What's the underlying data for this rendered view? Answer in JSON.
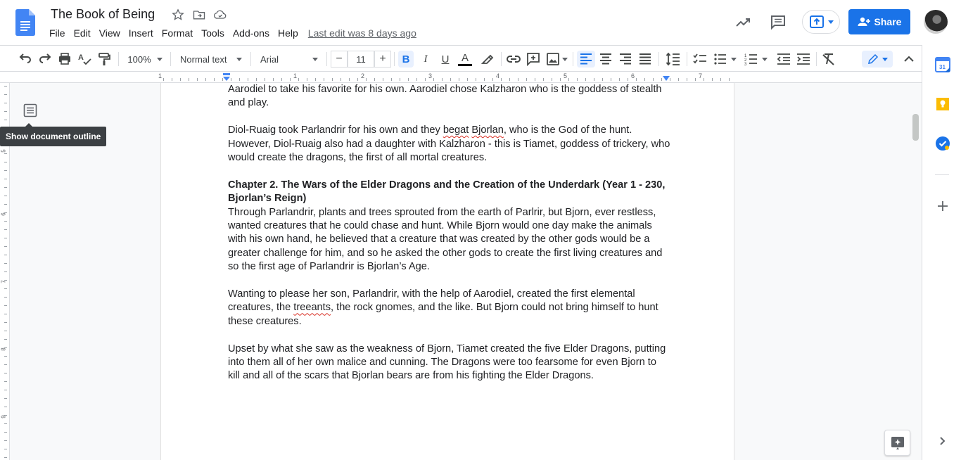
{
  "header": {
    "doc_title": "The Book of Being",
    "menu": [
      "File",
      "Edit",
      "View",
      "Insert",
      "Format",
      "Tools",
      "Add-ons",
      "Help"
    ],
    "last_edit": "Last edit was 8 days ago",
    "share_label": "Share"
  },
  "toolbar": {
    "zoom": "100%",
    "style": "Normal text",
    "font": "Arial",
    "font_size": "11"
  },
  "ruler": {
    "numbers": [
      "1",
      "1",
      "2",
      "3",
      "4",
      "5",
      "6",
      "7"
    ]
  },
  "vruler": {
    "numbers": [
      "5",
      "6",
      "7",
      "8",
      "9"
    ]
  },
  "outline": {
    "tooltip": "Show document outline"
  },
  "document": {
    "p1": "Aarodiel to take his favorite for his own. Aarodiel chose Kalzharon who is the goddess of stealth and play.",
    "p2_a": "Diol-Ruaig took Parlandrir for his own and they ",
    "p2_b": "begat",
    "p2_c": " ",
    "p2_d": "Bjorlan",
    "p2_e": ", who is the God of the hunt. However, Diol-Ruaig also had a daughter with Kalzharon - this is Tiamet, goddess of trickery, who would create the dragons, the first of all mortal creatures.",
    "heading": "Chapter 2. The Wars of the Elder Dragons and the Creation of the Underdark (Year 1 - 230, Bjorlan’s Reign)",
    "p3": "Through Parlandrir, plants and trees sprouted from the earth of Parlrir, but Bjorn, ever restless, wanted creatures that he could chase and hunt. While Bjorn would one day make the animals with his own hand, he believed that a creature that was created by the other gods would be a greater challenge for him, and so he asked the other gods to create the first living creatures and so the first age of Parlandrir is Bjorlan’s Age.",
    "p4_a": "Wanting to please her son, Parlandrir, with the help of Aarodiel, created the first elemental creatures, the ",
    "p4_b": "treeants",
    "p4_c": ", the rock gnomes, and the like. But Bjorn could not bring himself to hunt these creatures.",
    "p5": "Upset by what she saw as the weakness of Bjorn, Tiamet created the five Elder Dragons, putting into them all of her own malice and cunning. The Dragons were too fearsome for even Bjorn to kill and all of the scars that Bjorlan bears are from his fighting the Elder Dragons."
  },
  "side_panel": {
    "calendar_day": "31"
  },
  "colors": {
    "accent": "#1a73e8",
    "docs_blue": "#4285f4",
    "keep_yellow": "#fbbc04",
    "spell_red": "#d93025"
  }
}
